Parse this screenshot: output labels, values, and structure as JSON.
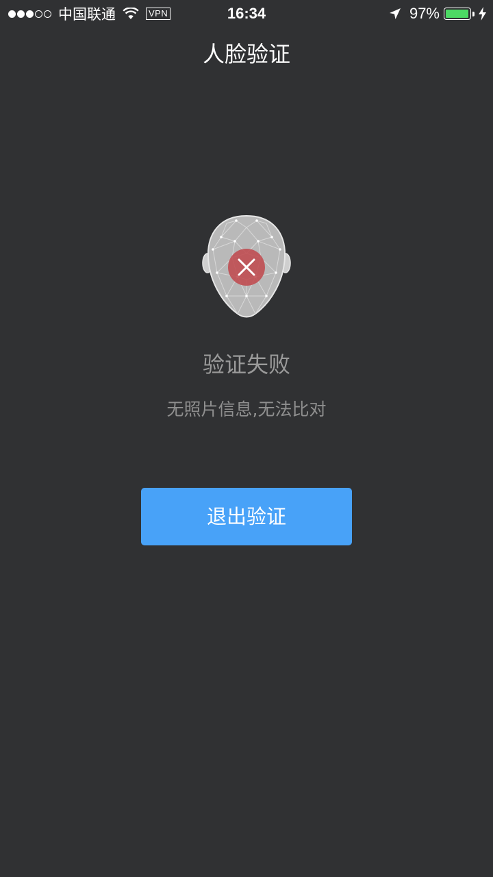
{
  "status_bar": {
    "signal_filled": 3,
    "signal_total": 5,
    "carrier": "中国联通",
    "vpn": "VPN",
    "time": "16:34",
    "battery_percent": "97%",
    "battery_level": 0.97,
    "battery_color": "#4cd964",
    "icons": [
      "wifi-icon",
      "location-arrow-icon",
      "battery-icon",
      "charging-bolt-icon"
    ]
  },
  "nav": {
    "title": "人脸验证"
  },
  "result": {
    "icon": "face-failure-icon",
    "title": "验证失败",
    "message": "无照片信息,无法比对"
  },
  "actions": {
    "exit_label": "退出验证",
    "exit_color": "#48a2f8"
  },
  "colors": {
    "background": "#303133",
    "error_red": "#b84a4d"
  }
}
